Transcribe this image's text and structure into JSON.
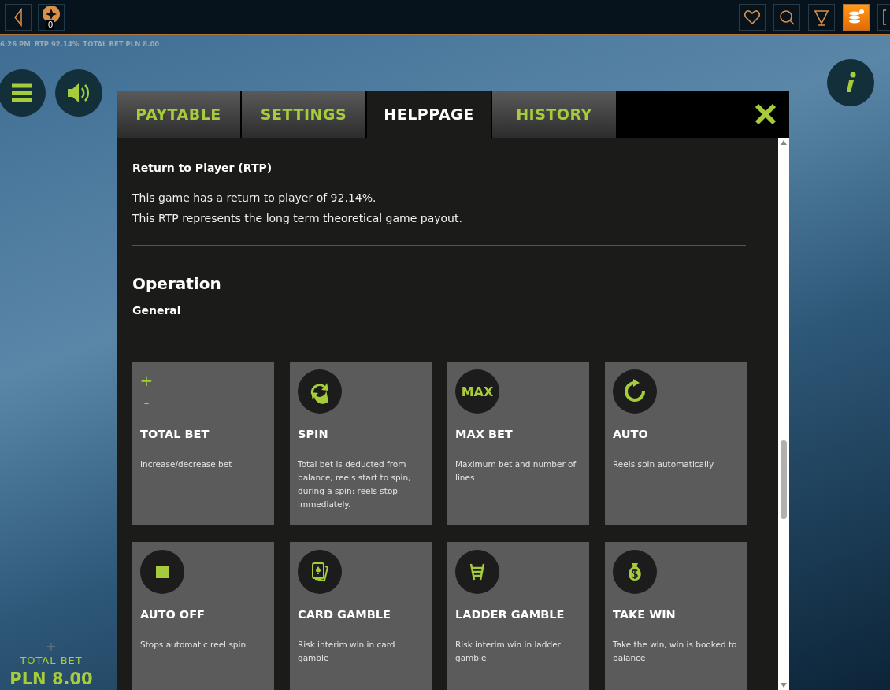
{
  "top_bar": {
    "avatar_badge": "0",
    "right_icons": [
      {
        "kind": "heart",
        "selected": false
      },
      {
        "kind": "search",
        "selected": false
      },
      {
        "kind": "trophy",
        "selected": false
      },
      {
        "kind": "coins",
        "selected": true
      },
      {
        "kind": "frame",
        "selected": false
      }
    ]
  },
  "status_line": [
    "6:26 PM",
    "RTP 92.14%",
    "TOTAL BET PLN 8.00"
  ],
  "bet_panel": {
    "symbol": "+",
    "label": "TOTAL BET",
    "value": "PLN 8.00"
  },
  "help_dialog": {
    "tabs": [
      {
        "label": "PAYTABLE",
        "selected": false
      },
      {
        "label": "SETTINGS",
        "selected": false
      },
      {
        "label": "HELPPAGE",
        "selected": true
      },
      {
        "label": "HISTORY",
        "selected": false
      }
    ],
    "rtp": {
      "heading": "Return to Player (RTP)",
      "paragraphs": [
        "This game has a return to player of 92.14%.",
        "This RTP represents the long term theoretical game payout."
      ]
    },
    "operation": {
      "heading": "Operation",
      "subheading": "General"
    },
    "cards": [
      {
        "kind": "plusminus",
        "symbols": [
          "+",
          "-"
        ],
        "title": "TOTAL BET",
        "text": "Increase/decrease bet"
      },
      {
        "kind": "spin",
        "title": "SPIN",
        "text": "Total bet is deducted from balance, reels start to spin, during a spin: reels stop immediately."
      },
      {
        "kind": "max",
        "icon_text": "MAX",
        "title": "MAX BET",
        "text": "Maximum bet and number of lines"
      },
      {
        "kind": "auto",
        "title": "AUTO",
        "text": "Reels spin automatically"
      },
      {
        "kind": "stop",
        "title": "AUTO OFF",
        "text": "Stops automatic reel spin"
      },
      {
        "kind": "cards",
        "title": "CARD GAMBLE",
        "text": "Risk interim win in card gamble"
      },
      {
        "kind": "ladder",
        "title": "LADDER GAMBLE",
        "text": "Risk interim win in ladder gamble"
      },
      {
        "kind": "moneybag",
        "title": "TAKE WIN",
        "text": "Take the win, win is booked to balance"
      }
    ]
  }
}
